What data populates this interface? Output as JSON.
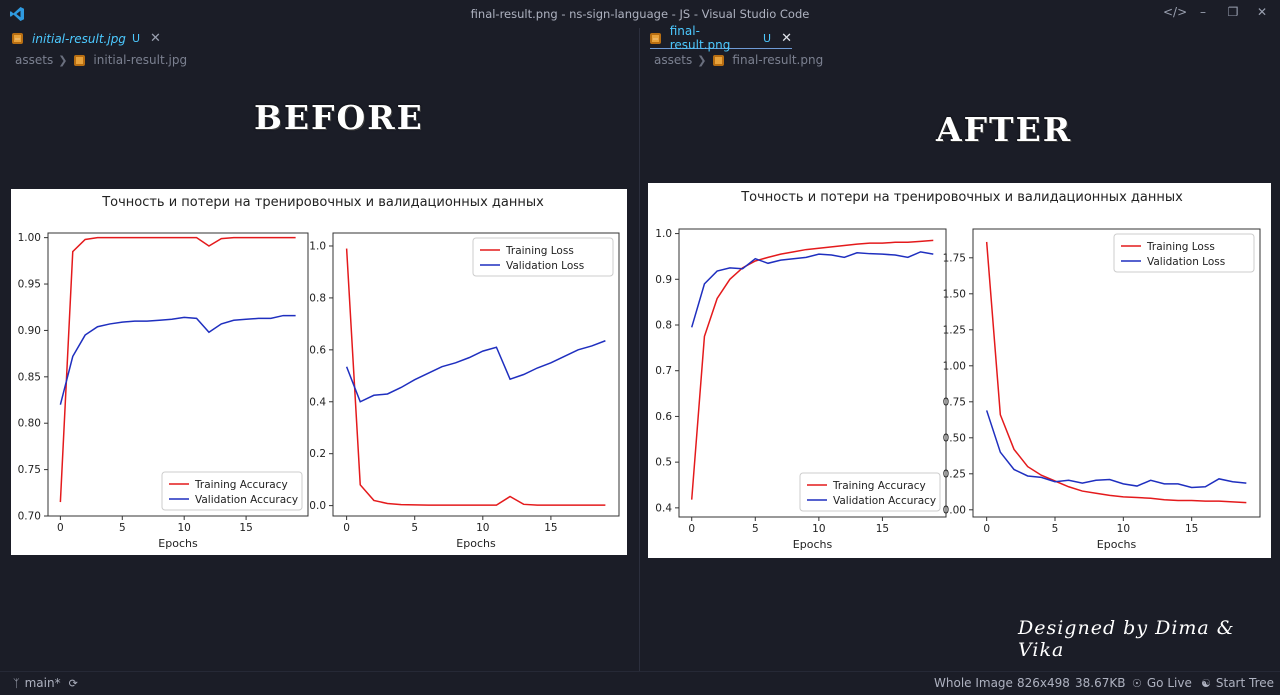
{
  "window": {
    "title": "final-result.png - ns-sign-language - JS - Visual Studio Code"
  },
  "left_editor": {
    "tab": {
      "name": "initial-result.jpg",
      "badge": "U"
    },
    "breadcrumb": [
      "assets",
      "initial-result.jpg"
    ],
    "heading": "BEFORE"
  },
  "right_editor": {
    "tab": {
      "name": "final-result.png",
      "badge": "U"
    },
    "breadcrumb": [
      "assets",
      "final-result.png"
    ],
    "heading": "AFTER",
    "credit": "Designed by Dima & Vika"
  },
  "statusbar": {
    "branch": "main*",
    "view": "Whole Image",
    "dimensions": "826x498",
    "size": "38.67KB",
    "golive": "Go Live",
    "starttree": "Start Tree"
  },
  "colors": {
    "training": "#e41a1c",
    "validation": "#1f2fbf",
    "tab_accent": "#4cc9ff"
  },
  "chart_data": [
    {
      "figure": "before",
      "title": "Точность и потери на тренировочных и валидационных данных",
      "subplots": [
        {
          "type": "line",
          "xlabel": "Epochs",
          "ylabel": "",
          "xlim": [
            -1,
            20
          ],
          "ylim": [
            0.7,
            1.005
          ],
          "xticks": [
            0,
            5,
            10,
            15
          ],
          "yticks": [
            0.7,
            0.75,
            0.8,
            0.85,
            0.9,
            0.95,
            1.0
          ],
          "ytick_labels": [
            "0.70",
            "0.75",
            "0.80",
            "0.85",
            "0.90",
            "0.95",
            "1.00"
          ],
          "legend": "lower-right",
          "x": [
            0,
            1,
            2,
            3,
            4,
            5,
            6,
            7,
            8,
            9,
            10,
            11,
            12,
            13,
            14,
            15,
            16,
            17,
            18,
            19
          ],
          "series": [
            {
              "name": "Training Accuracy",
              "color": "#e41a1c",
              "values": [
                0.715,
                0.985,
                0.998,
                1.0,
                1.0,
                1.0,
                1.0,
                1.0,
                1.0,
                1.0,
                1.0,
                1.0,
                0.991,
                0.999,
                1.0,
                1.0,
                1.0,
                1.0,
                1.0,
                1.0
              ]
            },
            {
              "name": "Validation Accuracy",
              "color": "#1f2fbf",
              "values": [
                0.82,
                0.872,
                0.895,
                0.904,
                0.907,
                0.909,
                0.91,
                0.91,
                0.911,
                0.912,
                0.914,
                0.913,
                0.898,
                0.907,
                0.911,
                0.912,
                0.913,
                0.913,
                0.916,
                0.916
              ]
            }
          ]
        },
        {
          "type": "line",
          "xlabel": "Epochs",
          "ylabel": "",
          "xlim": [
            -1,
            20
          ],
          "ylim": [
            -0.04,
            1.05
          ],
          "xticks": [
            0,
            5,
            10,
            15
          ],
          "yticks": [
            0.0,
            0.2,
            0.4,
            0.6,
            0.8,
            1.0
          ],
          "ytick_labels": [
            "0.0",
            "0.2",
            "0.4",
            "0.6",
            "0.8",
            "1.0"
          ],
          "legend": "top-right",
          "x": [
            0,
            1,
            2,
            3,
            4,
            5,
            6,
            7,
            8,
            9,
            10,
            11,
            12,
            13,
            14,
            15,
            16,
            17,
            18,
            19
          ],
          "series": [
            {
              "name": "Training Loss",
              "color": "#e41a1c",
              "values": [
                0.99,
                0.08,
                0.02,
                0.008,
                0.004,
                0.003,
                0.002,
                0.002,
                0.002,
                0.002,
                0.002,
                0.002,
                0.035,
                0.005,
                0.002,
                0.002,
                0.002,
                0.002,
                0.002,
                0.002
              ]
            },
            {
              "name": "Validation Loss",
              "color": "#1f2fbf",
              "values": [
                0.535,
                0.4,
                0.425,
                0.43,
                0.455,
                0.485,
                0.51,
                0.535,
                0.55,
                0.57,
                0.595,
                0.61,
                0.487,
                0.505,
                0.53,
                0.55,
                0.575,
                0.6,
                0.615,
                0.635
              ]
            }
          ]
        }
      ]
    },
    {
      "figure": "after",
      "title": "Точность и потери на тренировочных и валидационных данных",
      "subplots": [
        {
          "type": "line",
          "xlabel": "Epochs",
          "ylabel": "",
          "xlim": [
            -1,
            20
          ],
          "ylim": [
            0.38,
            1.01
          ],
          "xticks": [
            0,
            5,
            10,
            15
          ],
          "yticks": [
            0.4,
            0.5,
            0.6,
            0.7,
            0.8,
            0.9,
            1.0
          ],
          "ytick_labels": [
            "0.4",
            "0.5",
            "0.6",
            "0.7",
            "0.8",
            "0.9",
            "1.0"
          ],
          "legend": "lower-right",
          "x": [
            0,
            1,
            2,
            3,
            4,
            5,
            6,
            7,
            8,
            9,
            10,
            11,
            12,
            13,
            14,
            15,
            16,
            17,
            18,
            19
          ],
          "series": [
            {
              "name": "Training Accuracy",
              "color": "#e41a1c",
              "values": [
                0.418,
                0.775,
                0.858,
                0.9,
                0.925,
                0.94,
                0.948,
                0.955,
                0.96,
                0.965,
                0.968,
                0.971,
                0.974,
                0.977,
                0.979,
                0.979,
                0.981,
                0.981,
                0.983,
                0.985
              ]
            },
            {
              "name": "Validation Accuracy",
              "color": "#1f2fbf",
              "values": [
                0.795,
                0.89,
                0.918,
                0.925,
                0.923,
                0.945,
                0.935,
                0.942,
                0.945,
                0.948,
                0.955,
                0.953,
                0.948,
                0.958,
                0.956,
                0.955,
                0.953,
                0.948,
                0.96,
                0.955
              ]
            }
          ]
        },
        {
          "type": "line",
          "xlabel": "Epochs",
          "ylabel": "",
          "xlim": [
            -1,
            20
          ],
          "ylim": [
            -0.05,
            1.95
          ],
          "xticks": [
            0,
            5,
            10,
            15
          ],
          "yticks": [
            0.0,
            0.25,
            0.5,
            0.75,
            1.0,
            1.25,
            1.5,
            1.75
          ],
          "ytick_labels": [
            "0.00",
            "0.25",
            "0.50",
            "0.75",
            "1.00",
            "1.25",
            "1.50",
            "1.75"
          ],
          "legend": "top-right",
          "x": [
            0,
            1,
            2,
            3,
            4,
            5,
            6,
            7,
            8,
            9,
            10,
            11,
            12,
            13,
            14,
            15,
            16,
            17,
            18,
            19
          ],
          "series": [
            {
              "name": "Training Loss",
              "color": "#e41a1c",
              "values": [
                1.86,
                0.66,
                0.42,
                0.3,
                0.24,
                0.2,
                0.16,
                0.13,
                0.115,
                0.1,
                0.09,
                0.085,
                0.08,
                0.07,
                0.065,
                0.065,
                0.06,
                0.06,
                0.055,
                0.05
              ]
            },
            {
              "name": "Validation Loss",
              "color": "#1f2fbf",
              "values": [
                0.69,
                0.4,
                0.28,
                0.235,
                0.225,
                0.195,
                0.205,
                0.185,
                0.205,
                0.21,
                0.18,
                0.165,
                0.205,
                0.18,
                0.18,
                0.155,
                0.16,
                0.215,
                0.195,
                0.185
              ]
            }
          ]
        }
      ]
    }
  ]
}
